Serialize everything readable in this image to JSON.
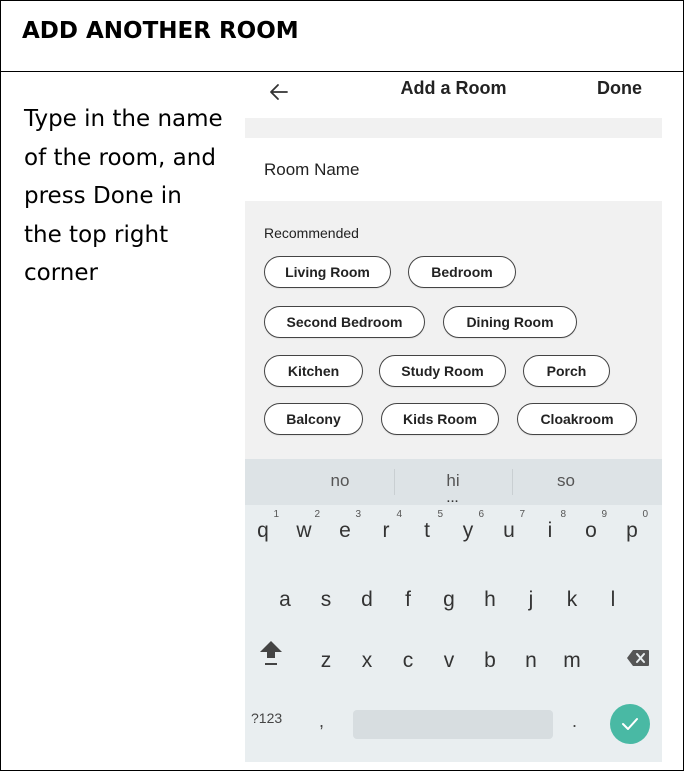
{
  "heading": "ADD ANOTHER ROOM",
  "instructions": "Type in the name of the room, and press Done in the top right corner",
  "appbar": {
    "back_icon": "arrow-left-icon",
    "title": "Add a Room",
    "done_label": "Done"
  },
  "room_name": {
    "placeholder": "Room Name",
    "value": ""
  },
  "recommended": {
    "label": "Recommended",
    "chips": [
      "Living Room",
      "Bedroom",
      "Second Bedroom",
      "Dining Room",
      "Kitchen",
      "Study Room",
      "Porch",
      "Balcony",
      "Kids Room",
      "Cloakroom"
    ]
  },
  "keyboard": {
    "suggestions": [
      "no",
      "hi",
      "so"
    ],
    "suggestion_more": "...",
    "row1": [
      {
        "key": "q",
        "num": "1"
      },
      {
        "key": "w",
        "num": "2"
      },
      {
        "key": "e",
        "num": "3"
      },
      {
        "key": "r",
        "num": "4"
      },
      {
        "key": "t",
        "num": "5"
      },
      {
        "key": "y",
        "num": "6"
      },
      {
        "key": "u",
        "num": "7"
      },
      {
        "key": "i",
        "num": "8"
      },
      {
        "key": "o",
        "num": "9"
      },
      {
        "key": "p",
        "num": "0"
      }
    ],
    "row2": [
      "a",
      "s",
      "d",
      "f",
      "g",
      "h",
      "j",
      "k",
      "l"
    ],
    "row3": [
      "z",
      "x",
      "c",
      "v",
      "b",
      "n",
      "m"
    ],
    "shift_icon": "shift-arrow-icon",
    "backspace_icon": "backspace-icon",
    "symbols_label": "?123",
    "comma": ",",
    "period": ".",
    "enter_icon": "checkmark-icon",
    "enter_color": "#49b9a4"
  }
}
